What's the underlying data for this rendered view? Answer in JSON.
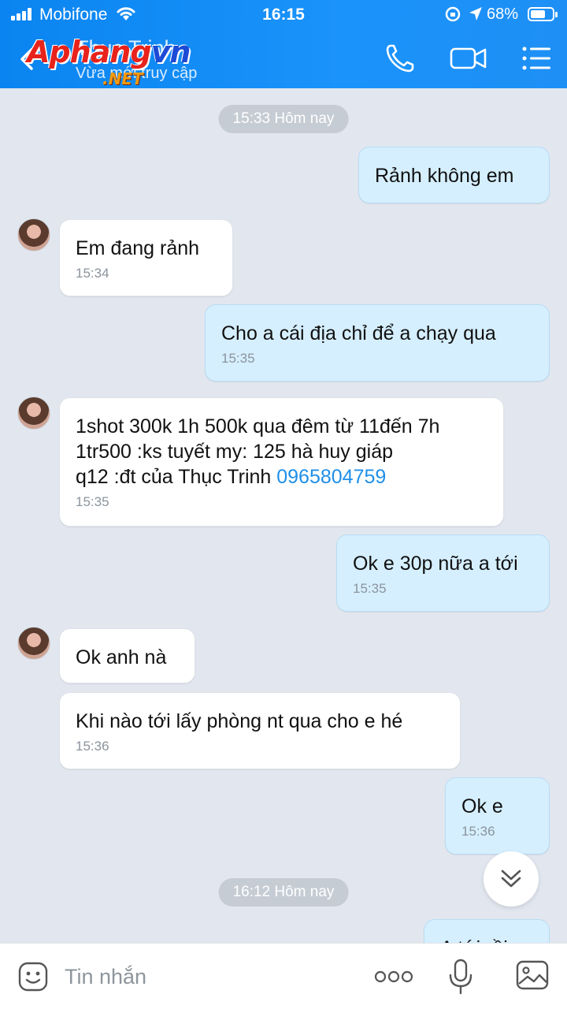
{
  "status_bar": {
    "carrier": "Mobifone",
    "time": "16:15",
    "battery_percent": "68%",
    "battery_level": 0.68
  },
  "header": {
    "contact_name": "Thục Trinh",
    "contact_status": "Vừa mới truy cập",
    "watermark_main": "Aphangvn",
    "watermark_sub": ".NET",
    "icons": [
      "back-icon",
      "phone-icon",
      "video-camera-icon",
      "menu-icon"
    ]
  },
  "chat": {
    "separators": [
      "15:33 Hôm nay",
      "16:12 Hôm nay"
    ],
    "messages": [
      {
        "dir": "out",
        "text": "Rảnh không em",
        "time": ""
      },
      {
        "dir": "in",
        "text": "Em đang rảnh",
        "time": "15:34"
      },
      {
        "dir": "out",
        "text": "Cho a cái địa chỉ để a chạy qua",
        "time": "15:35"
      },
      {
        "dir": "in",
        "text_line1": "1shot 300k 1h 500k qua đêm từ 11đến 7h",
        "text_line2": "1tr500 :ks tuyết my: 125 hà huy giáp",
        "text_line3": "q12 :đt của Thục Trinh ",
        "phone": "0965804759",
        "time": "15:35"
      },
      {
        "dir": "out",
        "text": "Ok e 30p nữa a tới",
        "time": "15:35"
      },
      {
        "dir": "in",
        "text": "Ok anh nà",
        "time": ""
      },
      {
        "dir": "in",
        "text": "Khi nào tới lấy phòng nt qua cho e hé",
        "time": "15:36"
      },
      {
        "dir": "out",
        "text": "Ok e",
        "time": "15:36"
      },
      {
        "dir": "out",
        "text": "A tới rồi",
        "time": ""
      }
    ]
  },
  "input_bar": {
    "placeholder": "Tin nhắn",
    "icons": [
      "emoji-icon",
      "more-icon",
      "microphone-icon",
      "image-icon"
    ]
  },
  "colors": {
    "header_blue": "#1a8ff6",
    "outgoing_bubble": "#d5efff",
    "incoming_bubble": "#ffffff",
    "background": "#e2e7ef",
    "link": "#1f8fe8"
  }
}
